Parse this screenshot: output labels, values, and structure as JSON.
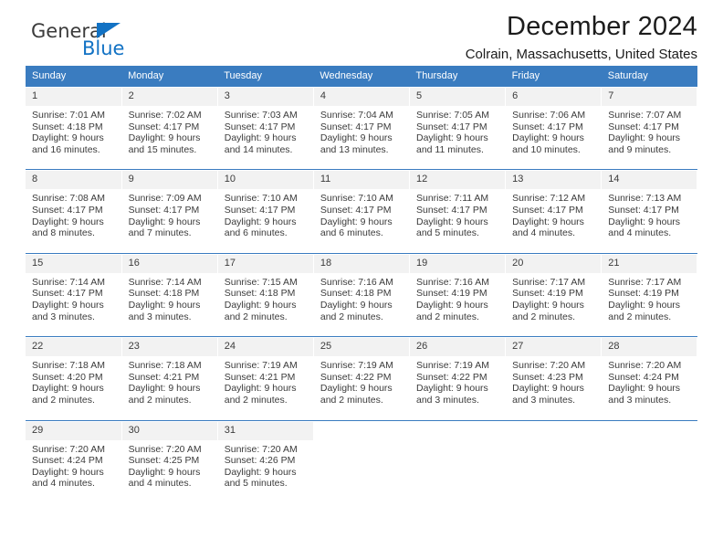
{
  "brand": {
    "name_part1": "General",
    "name_part2": "Blue",
    "triangle_icon": "blue-triangle-logo-mark",
    "accent_color": "#1272c4"
  },
  "header": {
    "title": "December 2024",
    "location": "Colrain, Massachusetts, United States"
  },
  "calendar": {
    "header_bg": "#3a7cc0",
    "daynum_bg": "#f2f2f2",
    "weekdays": [
      "Sunday",
      "Monday",
      "Tuesday",
      "Wednesday",
      "Thursday",
      "Friday",
      "Saturday"
    ],
    "weeks": [
      [
        {
          "day": "1",
          "sunrise": "Sunrise: 7:01 AM",
          "sunset": "Sunset: 4:18 PM",
          "daylight_line1": "Daylight: 9 hours",
          "daylight_line2": "and 16 minutes."
        },
        {
          "day": "2",
          "sunrise": "Sunrise: 7:02 AM",
          "sunset": "Sunset: 4:17 PM",
          "daylight_line1": "Daylight: 9 hours",
          "daylight_line2": "and 15 minutes."
        },
        {
          "day": "3",
          "sunrise": "Sunrise: 7:03 AM",
          "sunset": "Sunset: 4:17 PM",
          "daylight_line1": "Daylight: 9 hours",
          "daylight_line2": "and 14 minutes."
        },
        {
          "day": "4",
          "sunrise": "Sunrise: 7:04 AM",
          "sunset": "Sunset: 4:17 PM",
          "daylight_line1": "Daylight: 9 hours",
          "daylight_line2": "and 13 minutes."
        },
        {
          "day": "5",
          "sunrise": "Sunrise: 7:05 AM",
          "sunset": "Sunset: 4:17 PM",
          "daylight_line1": "Daylight: 9 hours",
          "daylight_line2": "and 11 minutes."
        },
        {
          "day": "6",
          "sunrise": "Sunrise: 7:06 AM",
          "sunset": "Sunset: 4:17 PM",
          "daylight_line1": "Daylight: 9 hours",
          "daylight_line2": "and 10 minutes."
        },
        {
          "day": "7",
          "sunrise": "Sunrise: 7:07 AM",
          "sunset": "Sunset: 4:17 PM",
          "daylight_line1": "Daylight: 9 hours",
          "daylight_line2": "and 9 minutes."
        }
      ],
      [
        {
          "day": "8",
          "sunrise": "Sunrise: 7:08 AM",
          "sunset": "Sunset: 4:17 PM",
          "daylight_line1": "Daylight: 9 hours",
          "daylight_line2": "and 8 minutes."
        },
        {
          "day": "9",
          "sunrise": "Sunrise: 7:09 AM",
          "sunset": "Sunset: 4:17 PM",
          "daylight_line1": "Daylight: 9 hours",
          "daylight_line2": "and 7 minutes."
        },
        {
          "day": "10",
          "sunrise": "Sunrise: 7:10 AM",
          "sunset": "Sunset: 4:17 PM",
          "daylight_line1": "Daylight: 9 hours",
          "daylight_line2": "and 6 minutes."
        },
        {
          "day": "11",
          "sunrise": "Sunrise: 7:10 AM",
          "sunset": "Sunset: 4:17 PM",
          "daylight_line1": "Daylight: 9 hours",
          "daylight_line2": "and 6 minutes."
        },
        {
          "day": "12",
          "sunrise": "Sunrise: 7:11 AM",
          "sunset": "Sunset: 4:17 PM",
          "daylight_line1": "Daylight: 9 hours",
          "daylight_line2": "and 5 minutes."
        },
        {
          "day": "13",
          "sunrise": "Sunrise: 7:12 AM",
          "sunset": "Sunset: 4:17 PM",
          "daylight_line1": "Daylight: 9 hours",
          "daylight_line2": "and 4 minutes."
        },
        {
          "day": "14",
          "sunrise": "Sunrise: 7:13 AM",
          "sunset": "Sunset: 4:17 PM",
          "daylight_line1": "Daylight: 9 hours",
          "daylight_line2": "and 4 minutes."
        }
      ],
      [
        {
          "day": "15",
          "sunrise": "Sunrise: 7:14 AM",
          "sunset": "Sunset: 4:17 PM",
          "daylight_line1": "Daylight: 9 hours",
          "daylight_line2": "and 3 minutes."
        },
        {
          "day": "16",
          "sunrise": "Sunrise: 7:14 AM",
          "sunset": "Sunset: 4:18 PM",
          "daylight_line1": "Daylight: 9 hours",
          "daylight_line2": "and 3 minutes."
        },
        {
          "day": "17",
          "sunrise": "Sunrise: 7:15 AM",
          "sunset": "Sunset: 4:18 PM",
          "daylight_line1": "Daylight: 9 hours",
          "daylight_line2": "and 2 minutes."
        },
        {
          "day": "18",
          "sunrise": "Sunrise: 7:16 AM",
          "sunset": "Sunset: 4:18 PM",
          "daylight_line1": "Daylight: 9 hours",
          "daylight_line2": "and 2 minutes."
        },
        {
          "day": "19",
          "sunrise": "Sunrise: 7:16 AM",
          "sunset": "Sunset: 4:19 PM",
          "daylight_line1": "Daylight: 9 hours",
          "daylight_line2": "and 2 minutes."
        },
        {
          "day": "20",
          "sunrise": "Sunrise: 7:17 AM",
          "sunset": "Sunset: 4:19 PM",
          "daylight_line1": "Daylight: 9 hours",
          "daylight_line2": "and 2 minutes."
        },
        {
          "day": "21",
          "sunrise": "Sunrise: 7:17 AM",
          "sunset": "Sunset: 4:19 PM",
          "daylight_line1": "Daylight: 9 hours",
          "daylight_line2": "and 2 minutes."
        }
      ],
      [
        {
          "day": "22",
          "sunrise": "Sunrise: 7:18 AM",
          "sunset": "Sunset: 4:20 PM",
          "daylight_line1": "Daylight: 9 hours",
          "daylight_line2": "and 2 minutes."
        },
        {
          "day": "23",
          "sunrise": "Sunrise: 7:18 AM",
          "sunset": "Sunset: 4:21 PM",
          "daylight_line1": "Daylight: 9 hours",
          "daylight_line2": "and 2 minutes."
        },
        {
          "day": "24",
          "sunrise": "Sunrise: 7:19 AM",
          "sunset": "Sunset: 4:21 PM",
          "daylight_line1": "Daylight: 9 hours",
          "daylight_line2": "and 2 minutes."
        },
        {
          "day": "25",
          "sunrise": "Sunrise: 7:19 AM",
          "sunset": "Sunset: 4:22 PM",
          "daylight_line1": "Daylight: 9 hours",
          "daylight_line2": "and 2 minutes."
        },
        {
          "day": "26",
          "sunrise": "Sunrise: 7:19 AM",
          "sunset": "Sunset: 4:22 PM",
          "daylight_line1": "Daylight: 9 hours",
          "daylight_line2": "and 3 minutes."
        },
        {
          "day": "27",
          "sunrise": "Sunrise: 7:20 AM",
          "sunset": "Sunset: 4:23 PM",
          "daylight_line1": "Daylight: 9 hours",
          "daylight_line2": "and 3 minutes."
        },
        {
          "day": "28",
          "sunrise": "Sunrise: 7:20 AM",
          "sunset": "Sunset: 4:24 PM",
          "daylight_line1": "Daylight: 9 hours",
          "daylight_line2": "and 3 minutes."
        }
      ],
      [
        {
          "day": "29",
          "sunrise": "Sunrise: 7:20 AM",
          "sunset": "Sunset: 4:24 PM",
          "daylight_line1": "Daylight: 9 hours",
          "daylight_line2": "and 4 minutes."
        },
        {
          "day": "30",
          "sunrise": "Sunrise: 7:20 AM",
          "sunset": "Sunset: 4:25 PM",
          "daylight_line1": "Daylight: 9 hours",
          "daylight_line2": "and 4 minutes."
        },
        {
          "day": "31",
          "sunrise": "Sunrise: 7:20 AM",
          "sunset": "Sunset: 4:26 PM",
          "daylight_line1": "Daylight: 9 hours",
          "daylight_line2": "and 5 minutes."
        },
        {
          "day": "",
          "sunrise": "",
          "sunset": "",
          "daylight_line1": "",
          "daylight_line2": ""
        },
        {
          "day": "",
          "sunrise": "",
          "sunset": "",
          "daylight_line1": "",
          "daylight_line2": ""
        },
        {
          "day": "",
          "sunrise": "",
          "sunset": "",
          "daylight_line1": "",
          "daylight_line2": ""
        },
        {
          "day": "",
          "sunrise": "",
          "sunset": "",
          "daylight_line1": "",
          "daylight_line2": ""
        }
      ]
    ]
  }
}
